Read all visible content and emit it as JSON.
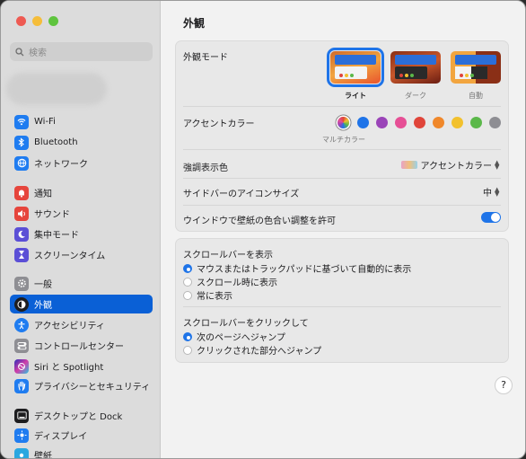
{
  "search": {
    "placeholder": "検索"
  },
  "sidebar": {
    "items": [
      {
        "label": "Wi-Fi",
        "icon": "wifi-icon",
        "color": "#1f7cf0"
      },
      {
        "label": "Bluetooth",
        "icon": "bluetooth-icon",
        "color": "#1f7cf0"
      },
      {
        "label": "ネットワーク",
        "icon": "globe-icon",
        "color": "#1f7cf0"
      },
      {
        "label": "通知",
        "icon": "bell-icon",
        "color": "#e6453c"
      },
      {
        "label": "サウンド",
        "icon": "speaker-icon",
        "color": "#e6453c"
      },
      {
        "label": "集中モード",
        "icon": "moon-icon",
        "color": "#5b4fd6"
      },
      {
        "label": "スクリーンタイム",
        "icon": "hourglass-icon",
        "color": "#5b4fd6"
      },
      {
        "label": "一般",
        "icon": "gear-icon",
        "color": "#8e8e93"
      },
      {
        "label": "外観",
        "icon": "appearance-icon",
        "color": "#1d1d1f"
      },
      {
        "label": "アクセシビリティ",
        "icon": "accessibility-icon",
        "color": "#1f7cf0"
      },
      {
        "label": "コントロールセンター",
        "icon": "control-center-icon",
        "color": "#8e8e93"
      },
      {
        "label": "Siri と Spotlight",
        "icon": "siri-icon",
        "color": "#6a3fd1"
      },
      {
        "label": "プライバシーとセキュリティ",
        "icon": "hand-icon",
        "color": "#1f7cf0"
      },
      {
        "label": "デスクトップと Dock",
        "icon": "dock-icon",
        "color": "#1d1d1f"
      },
      {
        "label": "ディスプレイ",
        "icon": "display-icon",
        "color": "#1f7cf0"
      },
      {
        "label": "壁紙",
        "icon": "wallpaper-icon",
        "color": "#2aa7e0"
      }
    ],
    "selected": "外観"
  },
  "main": {
    "title": "外観",
    "appearance": {
      "label": "外観モード",
      "options": [
        {
          "label": "ライト",
          "selected": true
        },
        {
          "label": "ダーク",
          "selected": false
        },
        {
          "label": "自動",
          "selected": false
        }
      ]
    },
    "accent": {
      "label": "アクセントカラー",
      "caption": "マルチカラー",
      "colors": [
        "multicolor",
        "#1f74e8",
        "#9a44b8",
        "#e64f95",
        "#e0453a",
        "#f0882b",
        "#f2c12e",
        "#5bb84a",
        "#8e8e93"
      ]
    },
    "highlight": {
      "label": "強調表示色",
      "value": "アクセントカラー"
    },
    "sidebar_icon": {
      "label": "サイドバーのアイコンサイズ",
      "value": "中"
    },
    "tinting": {
      "label": "ウインドウで壁紙の色合い調整を許可",
      "on": true
    },
    "show_scroll": {
      "label": "スクロールバーを表示",
      "options": [
        {
          "label": "マウスまたはトラックパッドに基づいて自動的に表示",
          "selected": true
        },
        {
          "label": "スクロール時に表示",
          "selected": false
        },
        {
          "label": "常に表示",
          "selected": false
        }
      ]
    },
    "click_scroll": {
      "label": "スクロールバーをクリックして",
      "options": [
        {
          "label": "次のページへジャンプ",
          "selected": true
        },
        {
          "label": "クリックされた部分へジャンプ",
          "selected": false
        }
      ]
    },
    "help": "?"
  }
}
